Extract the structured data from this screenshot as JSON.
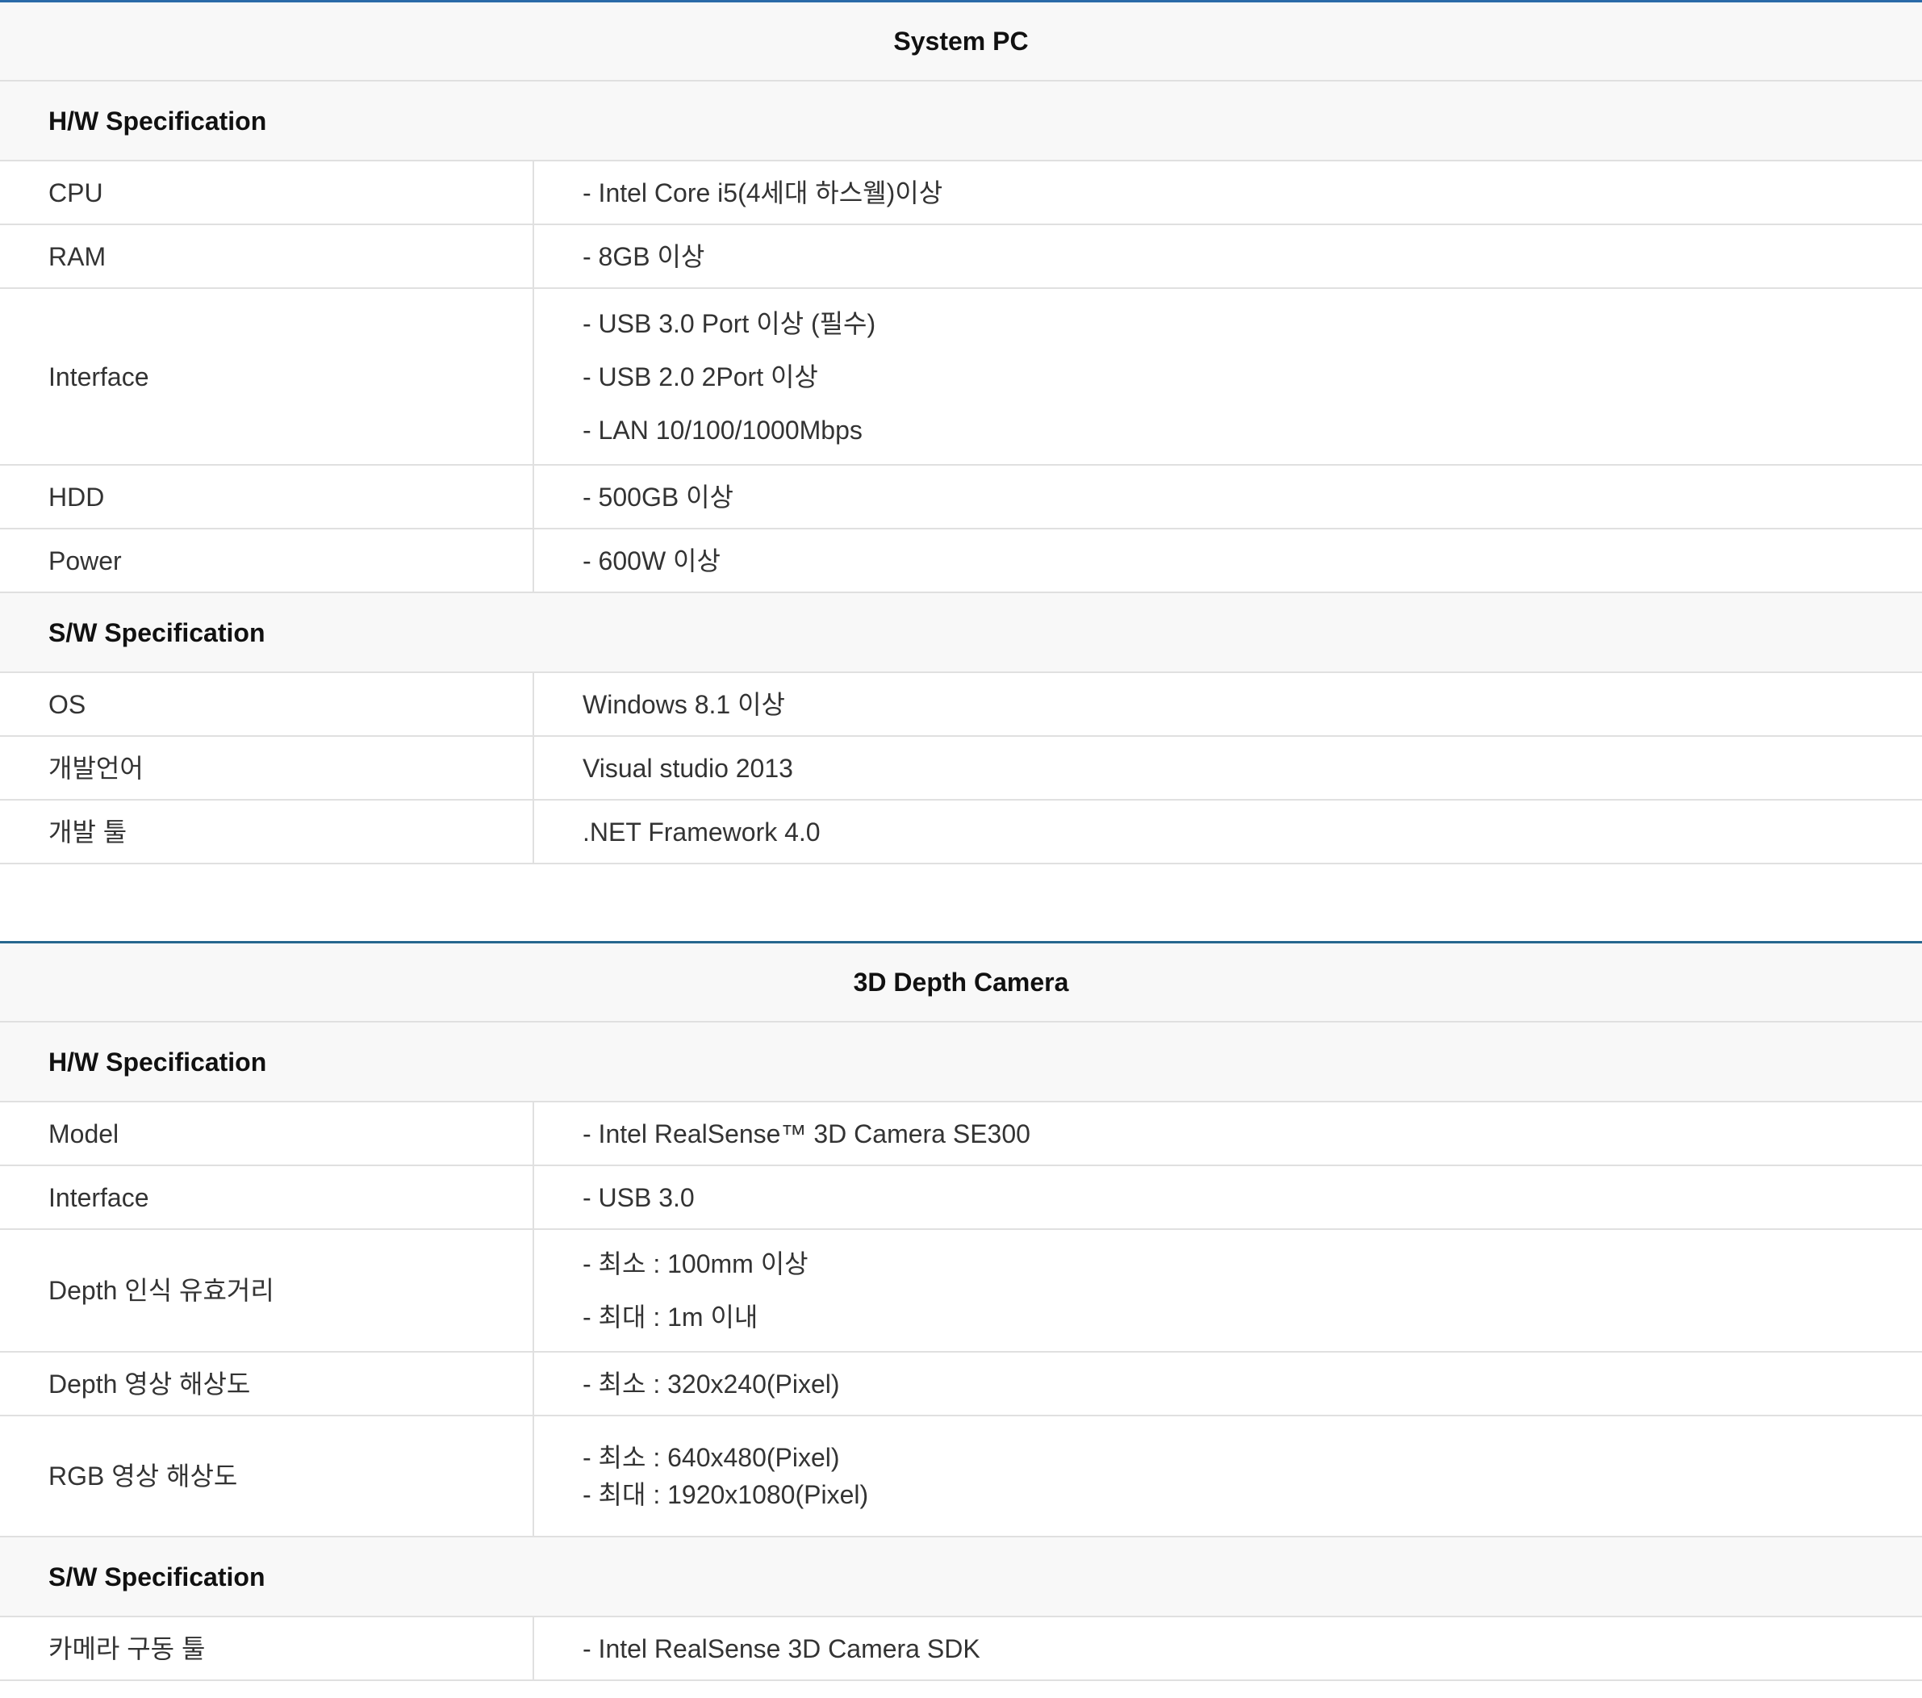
{
  "system_pc": {
    "title": "System PC",
    "hw_heading": "H/W Specification",
    "hw_rows": [
      {
        "label": "CPU",
        "values": [
          "- Intel Core i5(4세대 하스웰)이상"
        ]
      },
      {
        "label": "RAM",
        "values": [
          "- 8GB 이상"
        ]
      },
      {
        "label": "Interface",
        "values": [
          "- USB 3.0 Port 이상 (필수)",
          "- USB 2.0 2Port 이상",
          "- LAN 10/100/1000Mbps"
        ]
      },
      {
        "label": "HDD",
        "values": [
          "- 500GB 이상"
        ]
      },
      {
        "label": "Power",
        "values": [
          "- 600W 이상"
        ]
      }
    ],
    "sw_heading": "S/W Specification",
    "sw_rows": [
      {
        "label": "OS",
        "values": [
          "Windows 8.1 이상"
        ]
      },
      {
        "label": "개발언어",
        "values": [
          "Visual studio 2013"
        ]
      },
      {
        "label": "개발 툴",
        "values": [
          ".NET Framework 4.0"
        ]
      }
    ]
  },
  "depth_camera": {
    "title": "3D Depth Camera",
    "hw_heading": "H/W Specification",
    "hw_rows": [
      {
        "label": "Model",
        "values": [
          "- Intel RealSense™ 3D Camera SE300"
        ]
      },
      {
        "label": "Interface",
        "values": [
          "- USB 3.0"
        ]
      },
      {
        "label": "Depth 인식 유효거리",
        "values": [
          "- 최소 : 100mm 이상",
          "- 최대 : 1m 이내"
        ]
      },
      {
        "label": "Depth 영상 해상도",
        "values": [
          "- 최소 : 320x240(Pixel)"
        ]
      },
      {
        "label": "RGB 영상 해상도",
        "values": [
          "- 최소 : 640x480(Pixel)",
          "- 최대 : 1920x1080(Pixel)"
        ]
      }
    ],
    "sw_heading": "S/W Specification",
    "sw_rows": [
      {
        "label": "카메라 구동 툴",
        "values": [
          "- Intel RealSense 3D Camera SDK"
        ]
      }
    ]
  }
}
